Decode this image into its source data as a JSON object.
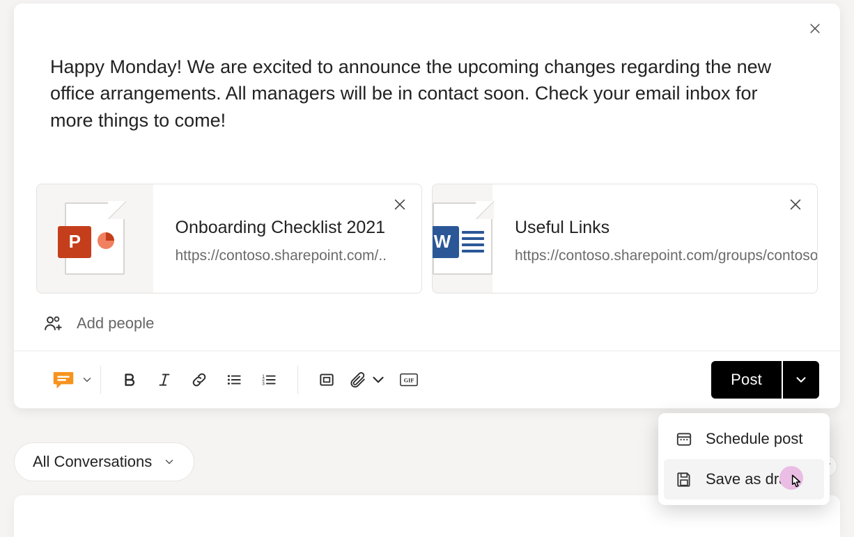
{
  "compose": {
    "text": "Happy Monday! We are excited to announce the upcoming changes regarding the new office arrangements. All managers will be in contact soon. Check your email inbox for more things to come!",
    "add_people_placeholder": "Add people"
  },
  "attachments": [
    {
      "icon": "powerpoint-icon",
      "badge": "P",
      "title": "Onboarding Checklist 2021",
      "url": "https://contoso.sharepoint.com/.."
    },
    {
      "icon": "word-icon",
      "badge": "W",
      "title": "Useful Links",
      "url": "https://contoso.sharepoint.com/groups/contosonewemployees/..."
    }
  ],
  "toolbar": {
    "post_label": "Post"
  },
  "dropdown": {
    "schedule_label": "Schedule post",
    "save_draft_label": "Save as draft"
  },
  "filter": {
    "label": "All Conversations"
  }
}
